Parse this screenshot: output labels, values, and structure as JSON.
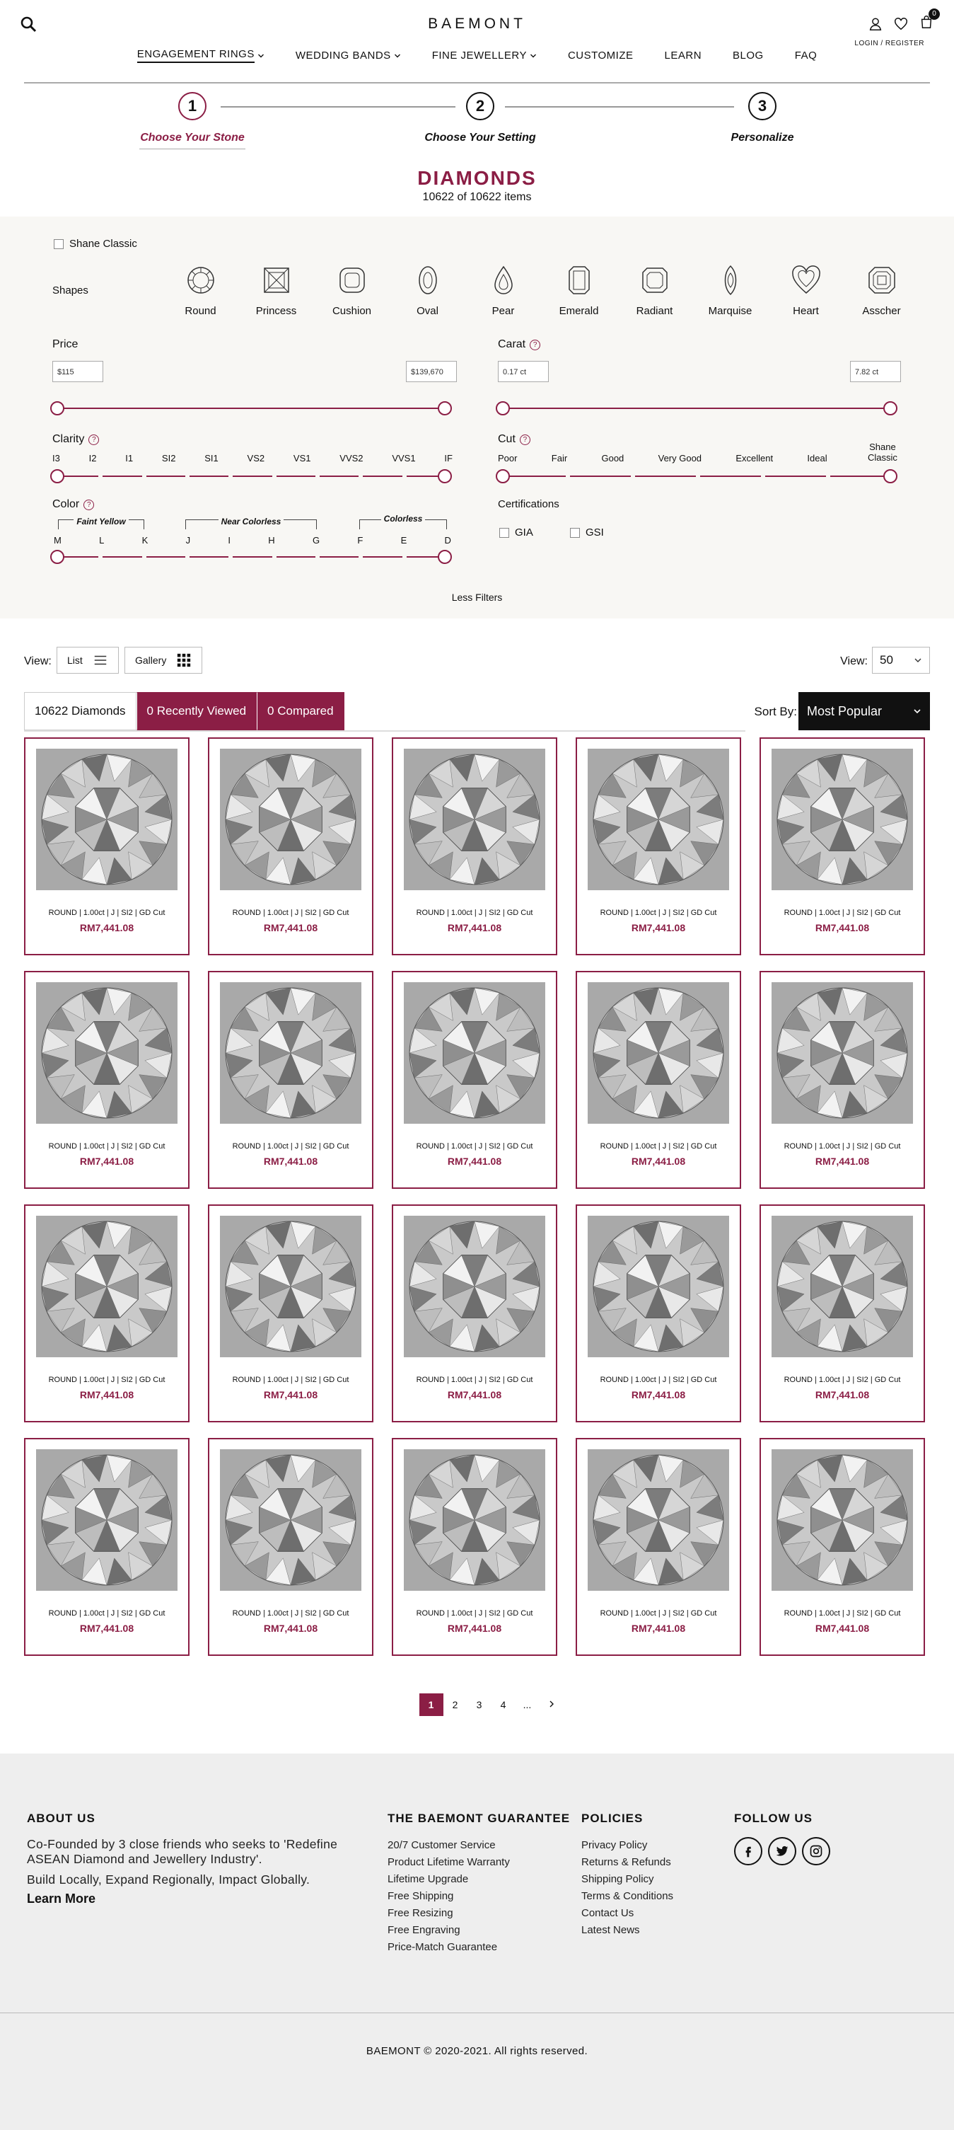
{
  "header": {
    "brand": "BAEMONT",
    "login_label": "LOGIN / REGISTER",
    "cart_count": "0",
    "nav": [
      {
        "label": "ENGAGEMENT RINGS",
        "dropdown": true
      },
      {
        "label": "WEDDING BANDS",
        "dropdown": true
      },
      {
        "label": "FINE JEWELLERY",
        "dropdown": true
      },
      {
        "label": "CUSTOMIZE",
        "dropdown": false
      },
      {
        "label": "LEARN",
        "dropdown": false
      },
      {
        "label": "BLOG",
        "dropdown": false
      },
      {
        "label": "FAQ",
        "dropdown": false
      }
    ]
  },
  "steps": [
    {
      "number": "1",
      "label": "Choose Your Stone"
    },
    {
      "number": "2",
      "label": "Choose Your Setting"
    },
    {
      "number": "3",
      "label": "Personalize"
    }
  ],
  "page": {
    "title": "DIAMONDS",
    "count": "10622 of 10622 items"
  },
  "filters": {
    "shane_classic": "Shane Classic",
    "shapes_label": "Shapes",
    "shapes": [
      "Round",
      "Princess",
      "Cushion",
      "Oval",
      "Pear",
      "Emerald",
      "Radiant",
      "Marquise",
      "Heart",
      "Asscher"
    ],
    "price": {
      "label": "Price",
      "min": "$115",
      "max": "$139,670"
    },
    "carat": {
      "label": "Carat",
      "min": "0.17 ct",
      "max": "7.82 ct"
    },
    "clarity": {
      "label": "Clarity",
      "ticks": [
        "I3",
        "I2",
        "I1",
        "SI2",
        "SI1",
        "VS2",
        "VS1",
        "VVS2",
        "VVS1",
        "IF"
      ]
    },
    "cut": {
      "label": "Cut",
      "ticks": [
        "Poor",
        "Fair",
        "Good",
        "Very Good",
        "Excellent",
        "Ideal",
        "Shane Classic"
      ]
    },
    "color": {
      "label": "Color",
      "ticks": [
        "M",
        "L",
        "K",
        "J",
        "I",
        "H",
        "G",
        "F",
        "E",
        "D"
      ],
      "groups": [
        "Faint Yellow",
        "Near Colorless",
        "Colorless"
      ]
    },
    "certifications": {
      "label": "Certifications",
      "options": [
        "GIA",
        "GSI"
      ]
    },
    "less_filters": "Less Filters"
  },
  "view": {
    "label": "View:",
    "list": "List",
    "gallery": "Gallery",
    "per_page_label": "View:",
    "per_page": "50"
  },
  "tabs": {
    "diamonds": "10622 Diamonds",
    "recent": "0 Recently Viewed",
    "compared": "0 Compared",
    "sort_label": "Sort By:",
    "sort_value": "Most Popular"
  },
  "products": [
    {
      "desc": "ROUND | 1.00ct | J | SI2 | GD Cut",
      "price": "RM7,441.08"
    },
    {
      "desc": "ROUND | 1.00ct | J | SI2 | GD Cut",
      "price": "RM7,441.08"
    },
    {
      "desc": "ROUND | 1.00ct | J | SI2 | GD Cut",
      "price": "RM7,441.08"
    },
    {
      "desc": "ROUND | 1.00ct | J | SI2 | GD Cut",
      "price": "RM7,441.08"
    },
    {
      "desc": "ROUND | 1.00ct | J | SI2 | GD Cut",
      "price": "RM7,441.08"
    },
    {
      "desc": "ROUND | 1.00ct | J | SI2 | GD Cut",
      "price": "RM7,441.08"
    },
    {
      "desc": "ROUND | 1.00ct | J | SI2 | GD Cut",
      "price": "RM7,441.08"
    },
    {
      "desc": "ROUND | 1.00ct | J | SI2 | GD Cut",
      "price": "RM7,441.08"
    },
    {
      "desc": "ROUND | 1.00ct | J | SI2 | GD Cut",
      "price": "RM7,441.08"
    },
    {
      "desc": "ROUND | 1.00ct | J | SI2 | GD Cut",
      "price": "RM7,441.08"
    },
    {
      "desc": "ROUND | 1.00ct | J | SI2 | GD Cut",
      "price": "RM7,441.08"
    },
    {
      "desc": "ROUND | 1.00ct | J | SI2 | GD Cut",
      "price": "RM7,441.08"
    },
    {
      "desc": "ROUND | 1.00ct | J | SI2 | GD Cut",
      "price": "RM7,441.08"
    },
    {
      "desc": "ROUND | 1.00ct | J | SI2 | GD Cut",
      "price": "RM7,441.08"
    },
    {
      "desc": "ROUND | 1.00ct | J | SI2 | GD Cut",
      "price": "RM7,441.08"
    },
    {
      "desc": "ROUND | 1.00ct | J | SI2 | GD Cut",
      "price": "RM7,441.08"
    },
    {
      "desc": "ROUND | 1.00ct | J | SI2 | GD Cut",
      "price": "RM7,441.08"
    },
    {
      "desc": "ROUND | 1.00ct | J | SI2 | GD Cut",
      "price": "RM7,441.08"
    },
    {
      "desc": "ROUND | 1.00ct | J | SI2 | GD Cut",
      "price": "RM7,441.08"
    },
    {
      "desc": "ROUND | 1.00ct | J | SI2 | GD Cut",
      "price": "RM7,441.08"
    }
  ],
  "pagination": [
    "1",
    "2",
    "3",
    "4",
    "..."
  ],
  "footer": {
    "about": {
      "title": "ABOUT US",
      "text1": "Co-Founded by 3 close friends who seeks to 'Redefine ASEAN Diamond and Jewellery Industry'.",
      "text2": "Build Locally, Expand Regionally, Impact Globally.",
      "learn_more": "Learn More"
    },
    "guarantee": {
      "title": "THE BAEMONT GUARANTEE",
      "links": [
        "20/7 Customer Service",
        "Product Lifetime Warranty",
        "Lifetime Upgrade",
        "Free Shipping",
        "Free Resizing",
        "Free Engraving",
        "Price-Match Guarantee"
      ]
    },
    "policies": {
      "title": "POLICIES",
      "links": [
        "Privacy Policy",
        "Returns & Refunds",
        "Shipping Policy",
        "Terms & Conditions",
        "Contact Us",
        "Latest News"
      ]
    },
    "follow": {
      "title": "FOLLOW US",
      "icons": [
        "facebook-icon",
        "twitter-icon",
        "instagram-icon"
      ]
    },
    "copyright": "BAEMONT © 2020-2021. All rights reserved."
  },
  "colors": {
    "accent": "#8b1e45",
    "filter_bg": "#f8f7f4",
    "footer_bg": "#eeeeee"
  }
}
